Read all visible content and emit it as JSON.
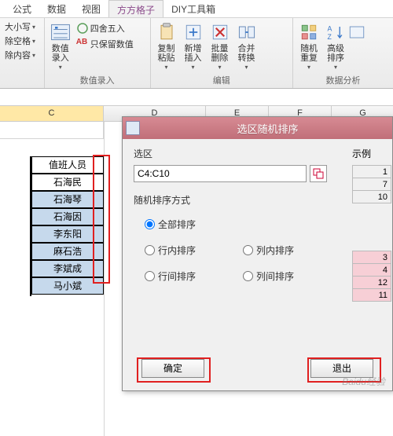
{
  "ribbon": {
    "tabs": [
      "公式",
      "数据",
      "视图",
      "方方格子",
      "DIY工具箱"
    ],
    "active": "方方格子",
    "g0": {
      "r0": "大小写",
      "r1": "除空格",
      "r2": "除内容",
      "drop": "▾"
    },
    "g1": {
      "big_label": "数值\n录入",
      "opt1": "四舍五入",
      "opt2": "只保留数值",
      "group_name": "数值录入"
    },
    "g2": {
      "i0": "复制\n粘贴",
      "i1": "新增\n插入",
      "i2": "批量\n删除",
      "i3": "合并\n转换",
      "group_name": "编辑"
    },
    "g3": {
      "i0": "随机\n重复",
      "i1": "高级\n排序",
      "group_name": "数据分析"
    }
  },
  "columns": [
    "C",
    "D",
    "E",
    "F",
    "G"
  ],
  "header_cell": "值班人员",
  "names": [
    "石海民",
    "石海琴",
    "石海因",
    "李东阳",
    "麻石浩",
    "李斌成",
    "马小斌"
  ],
  "dialog": {
    "title": "选区随机排序",
    "section_range": "选区",
    "range_value": "C4:C10",
    "section_mode": "随机排序方式",
    "opt_all": "全部排序",
    "opt_row_in": "行内排序",
    "opt_col_in": "列内排序",
    "opt_row_between": "行间排序",
    "opt_col_between": "列间排序",
    "example_label": "示例",
    "ex_top": [
      "1",
      "7",
      "10"
    ],
    "ex_bottom": [
      "3",
      "4",
      "12",
      "11"
    ],
    "ok": "确定",
    "exit": "退出"
  },
  "watermark": "Baidu经验"
}
